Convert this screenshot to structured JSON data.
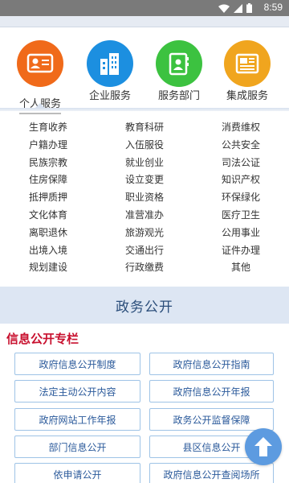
{
  "status_bar": {
    "time": "8:59",
    "icons": [
      "wifi-icon",
      "signal-icon",
      "battery-icon"
    ]
  },
  "services": [
    {
      "label": "个人服务",
      "icon": "id-card-icon",
      "color": "#f06a1a"
    },
    {
      "label": "企业服务",
      "icon": "building-icon",
      "color": "#1c8fe0"
    },
    {
      "label": "服务部门",
      "icon": "phone-book-icon",
      "color": "#3cc240"
    },
    {
      "label": "集成服务",
      "icon": "newspaper-icon",
      "color": "#f0a51e"
    }
  ],
  "categories": [
    [
      "生育收养",
      "教育科研",
      "消费维权"
    ],
    [
      "户籍办理",
      "入伍服役",
      "公共安全"
    ],
    [
      "民族宗教",
      "就业创业",
      "司法公证"
    ],
    [
      "住房保障",
      "设立变更",
      "知识产权"
    ],
    [
      "抵押质押",
      "职业资格",
      "环保绿化"
    ],
    [
      "文化体育",
      "准营准办",
      "医疗卫生"
    ],
    [
      "离职退休",
      "旅游观光",
      "公用事业"
    ],
    [
      "出境入境",
      "交通出行",
      "证件办理"
    ],
    [
      "规划建设",
      "行政缴费",
      "其他"
    ]
  ],
  "section": {
    "title": "政务公开"
  },
  "info": {
    "title": "信息公开专栏",
    "links": [
      [
        "政府信息公开制度",
        "政府信息公开指南"
      ],
      [
        "法定主动公开内容",
        "政府信息公开年报"
      ],
      [
        "政府网站工作年报",
        "政务公开监督保障"
      ],
      [
        "部门信息公开",
        "县区信息公开"
      ],
      [
        "依申请公开",
        "政府信息公开查阅场所"
      ]
    ]
  },
  "colors": {
    "accent": "#2b5a9b",
    "red_title": "#c8102e",
    "fab": "#5d9be0"
  }
}
